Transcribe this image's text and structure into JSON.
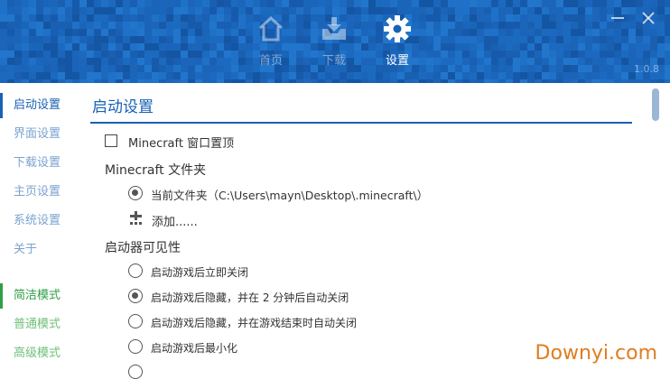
{
  "header": {
    "tabs": [
      {
        "label": "首页",
        "icon": "home-icon"
      },
      {
        "label": "下载",
        "icon": "download-icon"
      },
      {
        "label": "设置",
        "icon": "gear-icon",
        "active": true
      }
    ],
    "version": "1.0.8"
  },
  "sidebar": {
    "settings_items": [
      "启动设置",
      "界面设置",
      "下载设置",
      "主页设置",
      "系统设置",
      "关于"
    ],
    "mode_items": [
      "简洁模式",
      "普通模式",
      "高级模式"
    ]
  },
  "main": {
    "title": "启动设置",
    "topmost_checkbox": {
      "label": "Minecraft 窗口置顶",
      "checked": false
    },
    "folder_group": {
      "title": "Minecraft 文件夹",
      "current": {
        "label": "当前文件夹（C:\\Users\\mayn\\Desktop\\.minecraft\\）",
        "selected": true
      },
      "add_label": "添加......"
    },
    "visibility_group": {
      "title": "启动器可见性",
      "options": [
        {
          "label": "启动游戏后立即关闭",
          "selected": false
        },
        {
          "label": "启动游戏后隐藏，并在 2 分钟后自动关闭",
          "selected": true
        },
        {
          "label": "启动游戏后隐藏，并在游戏结束时自动关闭",
          "selected": false
        },
        {
          "label": "启动游戏后最小化",
          "selected": false
        }
      ]
    }
  },
  "watermark": "Downyi.com",
  "colors": {
    "header_blue": "#1861b4",
    "accent_green": "#2f9e44",
    "watermark_orange": "#e07d20"
  }
}
